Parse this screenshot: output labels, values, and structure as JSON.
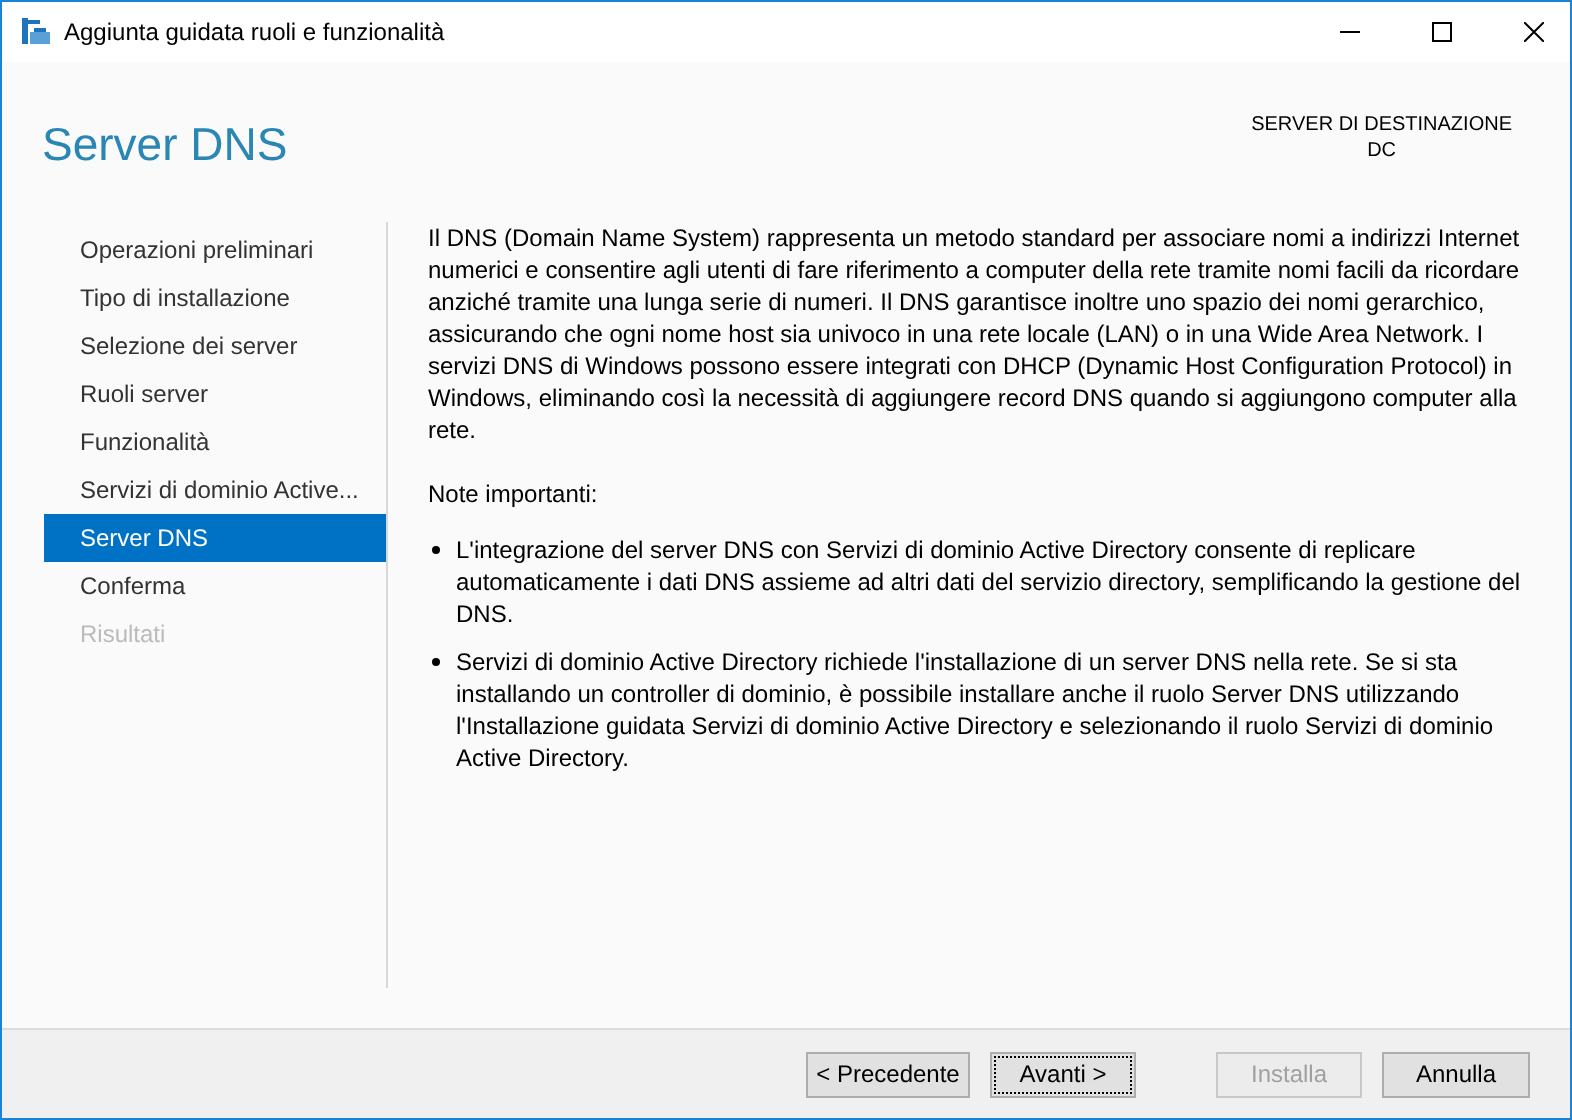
{
  "window": {
    "title": "Aggiunta guidata ruoli e funzionalità"
  },
  "page_title": "Server DNS",
  "destination": {
    "label": "SERVER DI DESTINAZIONE",
    "server": "DC"
  },
  "sidebar": {
    "items": [
      {
        "label": "Operazioni preliminari",
        "selected": false,
        "disabled": false
      },
      {
        "label": "Tipo di installazione",
        "selected": false,
        "disabled": false
      },
      {
        "label": "Selezione dei server",
        "selected": false,
        "disabled": false
      },
      {
        "label": "Ruoli server",
        "selected": false,
        "disabled": false
      },
      {
        "label": "Funzionalità",
        "selected": false,
        "disabled": false
      },
      {
        "label": "Servizi di dominio Active...",
        "selected": false,
        "disabled": false
      },
      {
        "label": "Server DNS",
        "selected": true,
        "disabled": false
      },
      {
        "label": "Conferma",
        "selected": false,
        "disabled": false
      },
      {
        "label": "Risultati",
        "selected": false,
        "disabled": true
      }
    ]
  },
  "content": {
    "intro": "Il DNS (Domain Name System) rappresenta un metodo standard per associare nomi a indirizzi Internet numerici e consentire agli utenti di fare riferimento a computer della rete tramite nomi facili da ricordare anziché tramite una lunga serie di numeri. Il DNS garantisce inoltre uno spazio dei nomi gerarchico, assicurando che ogni nome host sia univoco in una rete locale (LAN) o in una Wide Area Network. I servizi DNS di Windows possono essere integrati con DHCP (Dynamic Host Configuration Protocol) in Windows, eliminando così la necessità di aggiungere record DNS quando si aggiungono computer alla rete.",
    "notes_heading": "Note importanti:",
    "notes": [
      "L'integrazione del server DNS con Servizi di dominio Active Directory consente di replicare automaticamente i dati DNS assieme ad altri dati del servizio directory, semplificando la gestione del DNS.",
      "Servizi di dominio Active Directory richiede l'installazione di un server DNS nella rete. Se si sta installando un controller di dominio, è possibile installare anche il ruolo Server DNS utilizzando l'Installazione guidata Servizi di dominio Active Directory e selezionando il ruolo Servizi di dominio Active Directory."
    ]
  },
  "buttons": [
    {
      "label": "< Precedente",
      "disabled": false,
      "focused": false
    },
    {
      "label": "Avanti >",
      "disabled": false,
      "focused": true
    },
    {
      "label": "Installa",
      "disabled": true,
      "focused": false
    },
    {
      "label": "Annulla",
      "disabled": false,
      "focused": false
    }
  ]
}
